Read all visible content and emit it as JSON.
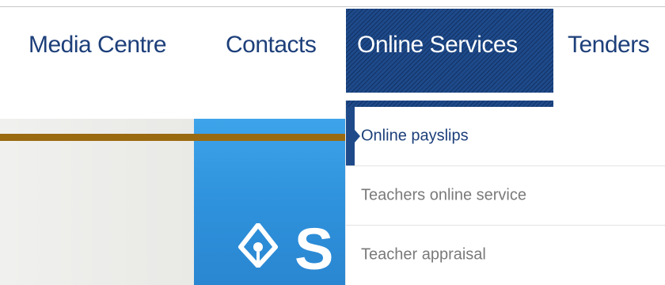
{
  "nav": {
    "items": [
      {
        "label": "Media Centre"
      },
      {
        "label": "Contacts"
      },
      {
        "label": "Online Services"
      },
      {
        "label": "Tenders"
      }
    ],
    "active_index": 2
  },
  "dropdown": {
    "items": [
      {
        "label": "Online payslips",
        "active": true
      },
      {
        "label": "Teachers online service",
        "active": false
      },
      {
        "label": "Teacher appraisal",
        "active": false
      }
    ]
  },
  "hero": {
    "logo_letter": "S"
  },
  "colors": {
    "nav_text": "#1d3f7a",
    "active_bg": "#1e4a8a",
    "hero_blue": "#3ea4ea",
    "hero_rule": "#9a6a10",
    "inactive_item_text": "#7a7a7a"
  }
}
